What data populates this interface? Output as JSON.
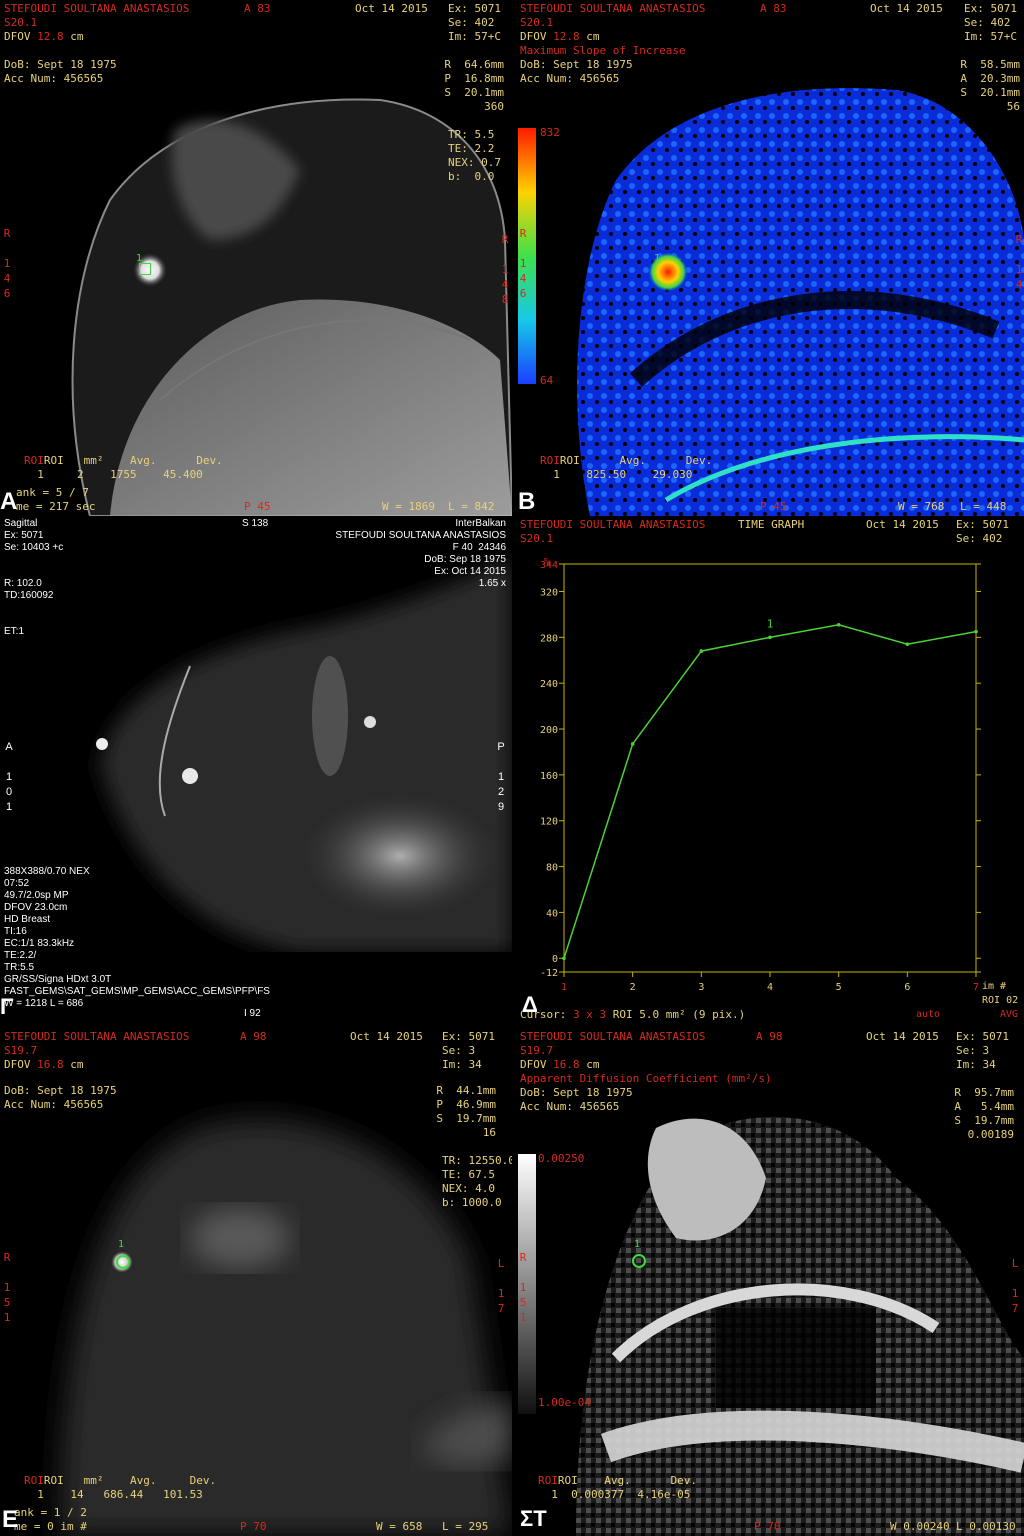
{
  "panelA": {
    "patient": "STEFOUDI SOULTANA ANASTASIOS",
    "series_id": "S20.1",
    "dfov_label": "DFOV",
    "dfov_value": "12.8",
    "dfov_unit": "cm",
    "dob": "DoB: Sept 18 1975",
    "acc": "Acc Num: 456565",
    "position_top": "A 83",
    "date": "Oct 14 2015",
    "ex": "Ex: 5071",
    "se": "Se: 402",
    "im": "Im: 57+C",
    "coords": "R  64.6mm\nP  16.8mm\nS  20.1mm\n       360",
    "params": "TR: 5.5\nTE: 2.2\nNEX: 0.7\nb:  0.0",
    "left_orient": "R\n\n1\n4\n6",
    "right_orient": "R\n\n1\n4\n8",
    "roi_header": "ROI   mm²    Avg.      Dev.",
    "roi_values": "  1     2    1755    45.400",
    "rank_line": "ank = 5 / 7",
    "time_line": "me = 217 sec",
    "p_value": "P 45",
    "window": "W = 1869",
    "level": "L = 842",
    "label": "A",
    "roi_marker": "1"
  },
  "panelB": {
    "patient": "STEFOUDI SOULTANA ANASTASIOS",
    "series_id": "S20.1",
    "dfov_label": "DFOV",
    "dfov_value": "12.8",
    "dfov_unit": "cm",
    "map_type": "Maximum Slope of Increase",
    "dob": "DoB: Sept 18 1975",
    "acc": "Acc Num: 456565",
    "position_top": "A 83",
    "date": "Oct 14 2015",
    "ex": "Ex: 5071",
    "se": "Se: 402",
    "im": "Im: 57+C",
    "coords": "R  58.5mm\nA  20.3mm\nS  20.1mm\n        56",
    "scale_max": "832",
    "scale_min": "64",
    "left_orient": "R\n\n1\n4\n6",
    "right_orient": "R\n\n1\n4",
    "roi_header": "ROI      Avg.      Dev.",
    "roi_values": "  1    825.50    29.030",
    "p_value": "P 45",
    "window": "W = 768",
    "level": "L = 448",
    "label": "B",
    "roi_marker": "1"
  },
  "panelG": {
    "plane": "Sagittal",
    "ex": "Ex: 5071",
    "se": "Se: 10403 +c",
    "slice": "S 138",
    "institution": "InterBalkan",
    "patient": "STEFOUDI SOULTANA ANASTASIOS",
    "sex_age": "F 40  24346",
    "dob": "DoB: Sep 18 1975",
    "exam_date": "Ex: Oct 14 2015",
    "zoom": "1.65 x",
    "r_line": "R: 102.0",
    "td_line": "TD:160092",
    "et_line": "ET:1",
    "left_orient": "A\n\n1\n0\n1",
    "right_orient": "P\n\n1\n2\n9",
    "params": "388X388/0.70 NEX\n07:52\n49.7/2.0sp MP\nDFOV 23.0cm\nHD Breast\nTI:16\nEC:1/1 83.3kHz\nTE:2.2/\nTR:5.5\nGR/SS/Signa HDxt 3.0T\nFAST_GEMS\\SAT_GEMS\\MP_GEMS\\ACC_GEMS\\PFP\\FS\nW = 1218 L = 686",
    "bottom_center": "I 92",
    "label": "Γ"
  },
  "panelD": {
    "patient": "STEFOUDI SOULTANA ANASTASIOS",
    "series_id": "S20.1",
    "graph_title": "TIME GRAPH",
    "date": "Oct 14 2015",
    "ex": "Ex: 5071",
    "se": "Se: 402",
    "y_unit": "%",
    "x_unit": "im #",
    "cursor_label": "Cursor:",
    "cursor_size": "3 x 3",
    "roi_info": "ROI 5.0 mm² (9 pix.)",
    "auto": "auto",
    "roi_id": "ROI 02",
    "avg": "AVG",
    "series_marker": "1",
    "label": "Δ"
  },
  "panelE": {
    "patient": "STEFOUDI SOULTANA ANASTASIOS",
    "series_id": "S19.7",
    "dfov_label": "DFOV",
    "dfov_value": "16.8",
    "dfov_unit": "cm",
    "dob": "DoB: Sept 18 1975",
    "acc": "Acc Num: 456565",
    "position_top": "A 98",
    "date": "Oct 14 2015",
    "ex": "Ex: 5071",
    "se": "Se: 3",
    "im": "Im: 34",
    "coords": "R  44.1mm\nP  46.9mm\nS  19.7mm\n        16",
    "params": "TR: 12550.0\nTE: 67.5\nNEX: 4.0\nb: 1000.0",
    "left_orient": "R\n\n1\n5\n1",
    "right_orient": "L\n\n1\n7",
    "roi_header": "ROI   mm²    Avg.     Dev.",
    "roi_values": "  1    14   686.44   101.53",
    "rank_line": "ank = 1 / 2",
    "time_line": "me = 0 im #",
    "p_value": "P 70",
    "window": "W = 658",
    "level": "L = 295",
    "label": "E",
    "roi_marker": "1"
  },
  "panelZ": {
    "patient": "STEFOUDI SOULTANA ANASTASIOS",
    "series_id": "S19.7",
    "dfov_label": "DFOV",
    "dfov_value": "16.8",
    "dfov_unit": "cm",
    "map_type": "Apparent Diffusion Coefficient (mm²/s)",
    "dob": "DoB: Sept 18 1975",
    "acc": "Acc Num: 456565",
    "position_top": "A 98",
    "date": "Oct 14 2015",
    "ex": "Ex: 5071",
    "se": "Se: 3",
    "im": "Im: 34",
    "coords": "R  95.7mm\nA   5.4mm\nS  19.7mm\n   0.00189",
    "scale_max": "0.00250",
    "scale_min": "1.00e-04",
    "left_orient": "R\n\n1\n5\n1",
    "right_orient": "L\n\n1\n7",
    "roi_header": "ROI    Avg.      Dev.",
    "roi_values": "  1  0.000377  4.16e-05",
    "p_value": "P 70",
    "window": "W 0.00240",
    "level": "L 0.00130",
    "label": "ΣΤ",
    "roi_marker": "1"
  },
  "chart_data": {
    "type": "line",
    "title": "TIME GRAPH",
    "xlabel": "im #",
    "ylabel": "%",
    "x": [
      1,
      2,
      3,
      4,
      5,
      6,
      7
    ],
    "series": [
      {
        "name": "1",
        "values": [
          0,
          187,
          268,
          280,
          291,
          274,
          285
        ]
      }
    ],
    "x_ticks": [
      "1",
      "2",
      "3",
      "4",
      "5",
      "6",
      "7"
    ],
    "y_ticks": [
      "344",
      "320",
      "280",
      "240",
      "200",
      "160",
      "120",
      "80",
      "40",
      "0",
      "-12"
    ],
    "ylim": [
      -12,
      344
    ],
    "xlim": [
      1,
      7
    ],
    "line_color": "#4cd137",
    "axis_color": "#c8b400",
    "grid": false
  }
}
